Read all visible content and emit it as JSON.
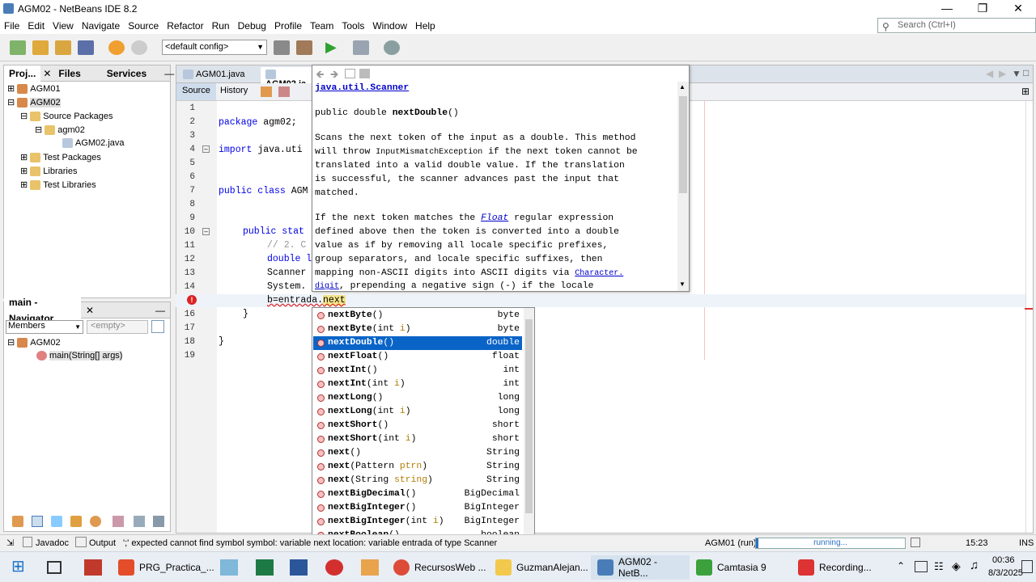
{
  "window": {
    "title": "AGM02 - NetBeans IDE 8.2"
  },
  "menu": [
    "File",
    "Edit",
    "View",
    "Navigate",
    "Source",
    "Refactor",
    "Run",
    "Debug",
    "Profile",
    "Team",
    "Tools",
    "Window",
    "Help"
  ],
  "search": {
    "placeholder": "Search (Ctrl+I)"
  },
  "toolbar": {
    "config": "<default config>"
  },
  "projects": {
    "tabs": [
      "Proj...",
      "Files",
      "Services"
    ],
    "tree": [
      "AGM01",
      "AGM02",
      "Source Packages",
      "agm02",
      "AGM02.java",
      "Test Packages",
      "Libraries",
      "Test Libraries"
    ]
  },
  "navigator": {
    "title": "main - Navigator",
    "filter": "Members",
    "empty": "<empty>",
    "items": [
      "AGM02",
      "main(String[] args)"
    ]
  },
  "editor": {
    "tabs": [
      "AGM01.java",
      "AGM02.ja"
    ],
    "subtabs": [
      "Source",
      "History"
    ],
    "lines": [
      "1",
      "2",
      "3",
      "4",
      "5",
      "6",
      "7",
      "8",
      "9",
      "10",
      "11",
      "12",
      "13",
      "14",
      "15",
      "16",
      "17",
      "18",
      "19"
    ],
    "code": {
      "l2a": "package",
      "l2b": " agm02;",
      "l4a": "import",
      "l4b": " java.uti",
      "l7a": "public class",
      "l7b": " AGM",
      "l10a": "public stat",
      "l11": "// 2. C",
      "l12": "double l",
      "l13": "Scanner",
      "l14": "System.",
      "l15a": "b=entrada.",
      "l15b": "next",
      "l16": "}",
      "l18": "}"
    }
  },
  "javadoc": {
    "class_link": "java.util.Scanner",
    "signature_pre": "public double ",
    "signature_name": "nextDouble",
    "signature_post": "()",
    "p1": [
      "Scans the next token of the input as a double. This method",
      "will throw ",
      "InputMismatchException",
      " if the next token cannot be",
      "translated into a valid double value. If the translation",
      "is successful, the scanner advances past the input that",
      "matched."
    ],
    "p2a": "If the next token matches the ",
    "p2link": "Float",
    "p2b": " regular expression",
    "p2": [
      "defined above then the token is converted into a double",
      "value as if by removing all locale specific prefixes,",
      "group separators, and locale specific suffixes, then",
      "mapping non-ASCII digits into ASCII digits via "
    ],
    "link2a": "Character.",
    "link2b": "digit",
    "p2end": ", prepending a negative sign (-) if the locale"
  },
  "completion": [
    {
      "name": "nextByte",
      "params": "()",
      "ptype": "",
      "type": "byte"
    },
    {
      "name": "nextByte",
      "params": "(int ",
      "ptype": "i",
      "pend": ")",
      "type": "byte"
    },
    {
      "name": "nextDouble",
      "params": "()",
      "ptype": "",
      "type": "double",
      "selected": true
    },
    {
      "name": "nextFloat",
      "params": "()",
      "ptype": "",
      "type": "float"
    },
    {
      "name": "nextInt",
      "params": "()",
      "ptype": "",
      "type": "int"
    },
    {
      "name": "nextInt",
      "params": "(int ",
      "ptype": "i",
      "pend": ")",
      "type": "int"
    },
    {
      "name": "nextLong",
      "params": "()",
      "ptype": "",
      "type": "long"
    },
    {
      "name": "nextLong",
      "params": "(int ",
      "ptype": "i",
      "pend": ")",
      "type": "long"
    },
    {
      "name": "nextShort",
      "params": "()",
      "ptype": "",
      "type": "short"
    },
    {
      "name": "nextShort",
      "params": "(int ",
      "ptype": "i",
      "pend": ")",
      "type": "short"
    },
    {
      "name": "next",
      "params": "()",
      "ptype": "",
      "type": "String"
    },
    {
      "name": "next",
      "params": "(Pattern ",
      "ptype": "ptrn",
      "pend": ")",
      "type": "String"
    },
    {
      "name": "next",
      "params": "(String ",
      "ptype": "string",
      "pend": ")",
      "type": "String"
    },
    {
      "name": "nextBigDecimal",
      "params": "()",
      "ptype": "",
      "type": "BigDecimal"
    },
    {
      "name": "nextBigInteger",
      "params": "()",
      "ptype": "",
      "type": "BigInteger"
    },
    {
      "name": "nextBigInteger",
      "params": "(int ",
      "ptype": "i",
      "pend": ")",
      "type": "BigInteger"
    },
    {
      "name": "nextBoolean",
      "params": "()",
      "ptype": "",
      "type": "boolean"
    }
  ],
  "status": {
    "javadoc": "Javadoc",
    "output": "Output",
    "message": "';' expected  cannot find symbol  symbol:  variable next  location: variable entrada of type Scanner",
    "run": "AGM01 (run)",
    "running": "running...",
    "position": "15:23",
    "mode": "INS"
  },
  "taskbar": {
    "items": [
      "PRG_Practica_...",
      "RecursosWeb ...",
      "GuzmanAlejan...",
      "AGM02 - NetB...",
      "Camtasia 9",
      "Recording..."
    ],
    "time": "00:36",
    "date": "8/3/2025"
  },
  "colors": {
    "selection": "#0a64c8",
    "keyword": "#0000e6",
    "link": "#0000cc"
  }
}
